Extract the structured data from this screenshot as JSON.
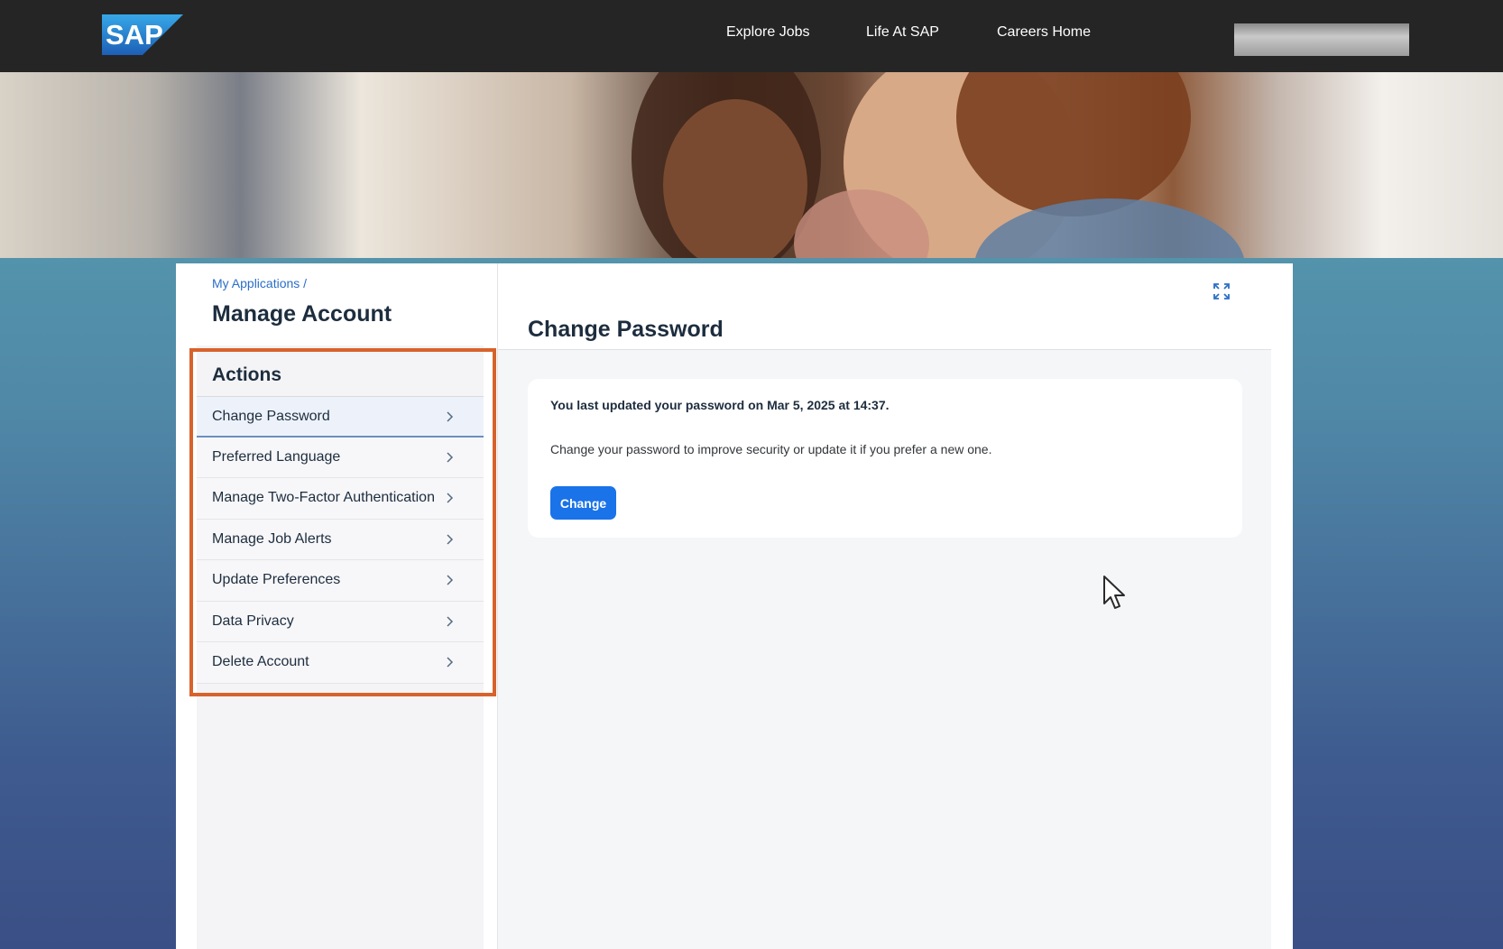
{
  "header": {
    "logo_text": "SAP",
    "nav": [
      "Explore Jobs",
      "Life At SAP",
      "Careers Home"
    ]
  },
  "sidebar": {
    "breadcrumb": "My Applications /",
    "title": "Manage Account",
    "actions_heading": "Actions",
    "items": [
      {
        "label": "Change Password",
        "selected": true
      },
      {
        "label": "Preferred Language",
        "selected": false
      },
      {
        "label": "Manage Two-Factor Authentication",
        "selected": false
      },
      {
        "label": "Manage Job Alerts",
        "selected": false
      },
      {
        "label": "Update Preferences",
        "selected": false
      },
      {
        "label": "Data Privacy",
        "selected": false
      },
      {
        "label": "Delete Account",
        "selected": false
      }
    ]
  },
  "content": {
    "title": "Change Password",
    "last_updated": "You last updated your password on Mar 5, 2025 at 14:37.",
    "description": "Change your password to improve security or update it if you prefer a new one.",
    "change_button": "Change"
  },
  "colors": {
    "topbar": "#252525",
    "primary_button": "#1a73e8",
    "highlight_frame": "#d8622c",
    "link": "#2a6ec7"
  },
  "icons": [
    "chevron-right-icon",
    "expand-icon",
    "mouse-cursor-icon"
  ]
}
